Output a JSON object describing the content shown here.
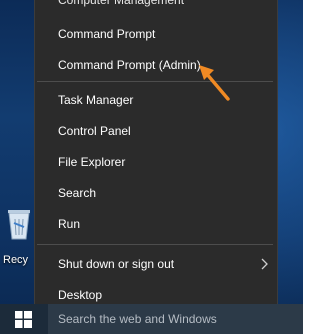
{
  "menu": {
    "items_top": [
      {
        "label": "Computer Management"
      },
      {
        "label": "Command Prompt"
      },
      {
        "label": "Command Prompt (Admin)"
      }
    ],
    "items_middle": [
      {
        "label": "Task Manager"
      },
      {
        "label": "Control Panel"
      },
      {
        "label": "File Explorer"
      },
      {
        "label": "Search"
      },
      {
        "label": "Run"
      }
    ],
    "items_bottom": [
      {
        "label": "Shut down or sign out"
      },
      {
        "label": "Desktop"
      }
    ]
  },
  "desktop": {
    "recycle_label": "Recy"
  },
  "taskbar": {
    "search_placeholder": "Search the web and Windows"
  },
  "colors": {
    "menu_bg": "#2b2b2b",
    "annotation_arrow": "#f08a24",
    "desktop_bg": "#123c70"
  }
}
